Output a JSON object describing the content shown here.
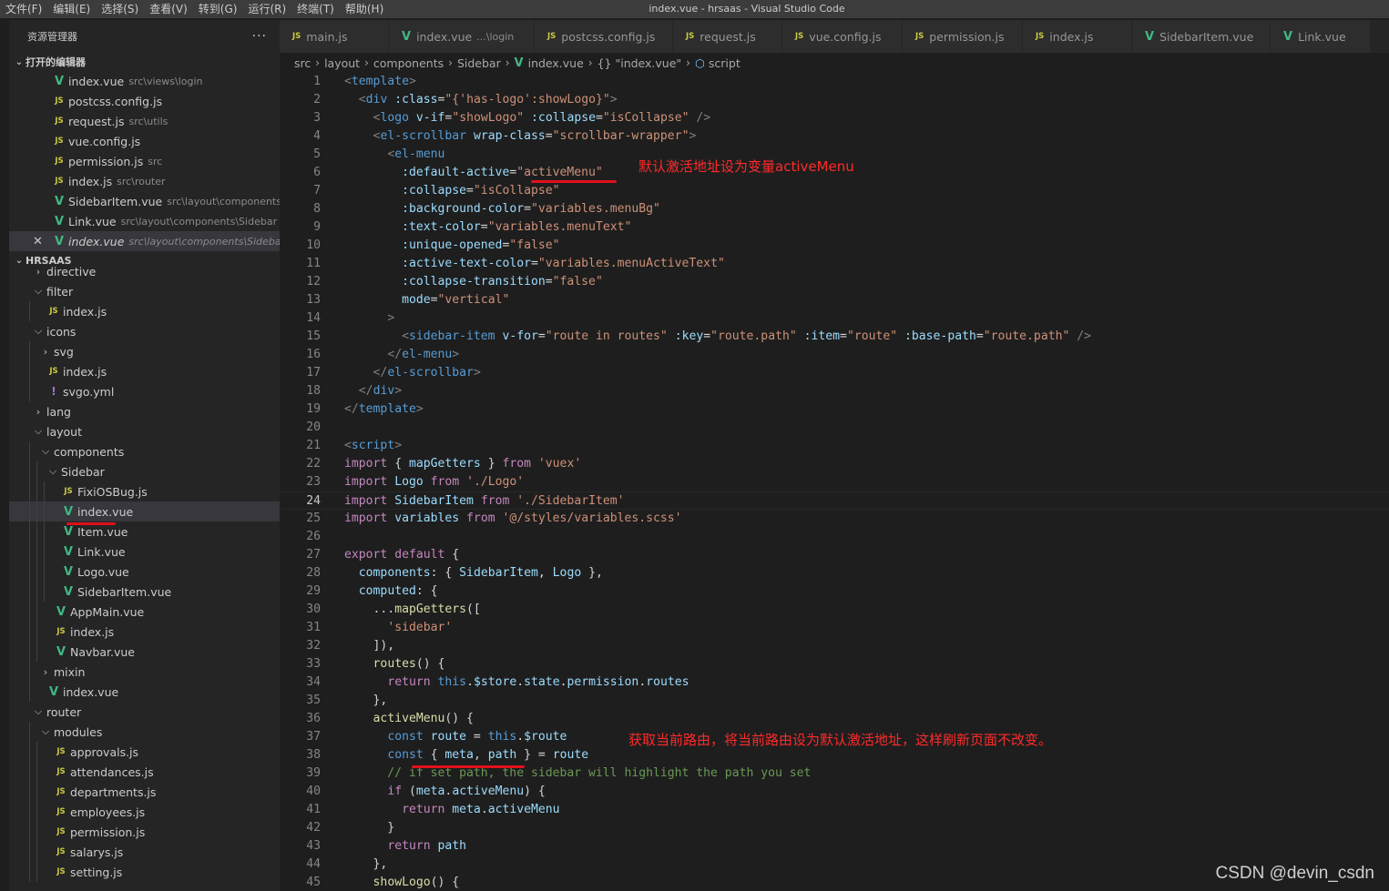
{
  "menu": [
    "文件(F)",
    "编辑(E)",
    "选择(S)",
    "查看(V)",
    "转到(G)",
    "运行(R)",
    "终端(T)",
    "帮助(H)"
  ],
  "window_title": "index.vue - hrsaas - Visual Studio Code",
  "explorer": {
    "title": "资源管理器",
    "more": "···",
    "open_editors_label": "打开的编辑器",
    "open_editors": [
      {
        "icon": "vue",
        "name": "index.vue",
        "path": "src\\views\\login"
      },
      {
        "icon": "js",
        "name": "postcss.config.js",
        "path": ""
      },
      {
        "icon": "js",
        "name": "request.js",
        "path": "src\\utils"
      },
      {
        "icon": "js",
        "name": "vue.config.js",
        "path": ""
      },
      {
        "icon": "js",
        "name": "permission.js",
        "path": "src"
      },
      {
        "icon": "js",
        "name": "index.js",
        "path": "src\\router"
      },
      {
        "icon": "vue",
        "name": "SidebarItem.vue",
        "path": "src\\layout\\components\\..."
      },
      {
        "icon": "vue",
        "name": "Link.vue",
        "path": "src\\layout\\components\\Sidebar"
      },
      {
        "icon": "vue",
        "name": "index.vue",
        "path": "src\\layout\\components\\Sidebar"
      }
    ],
    "project_label": "HRSAAS",
    "tree": [
      {
        "d": 1,
        "t": "dir",
        "o": false,
        "name": "directive"
      },
      {
        "d": 1,
        "t": "dir",
        "o": true,
        "name": "filter"
      },
      {
        "d": 2,
        "t": "js",
        "name": "index.js"
      },
      {
        "d": 1,
        "t": "dir",
        "o": true,
        "name": "icons"
      },
      {
        "d": 2,
        "t": "dir",
        "o": false,
        "name": "svg"
      },
      {
        "d": 2,
        "t": "js",
        "name": "index.js"
      },
      {
        "d": 2,
        "t": "yml",
        "name": "svgo.yml"
      },
      {
        "d": 1,
        "t": "dir",
        "o": false,
        "name": "lang"
      },
      {
        "d": 1,
        "t": "dir",
        "o": true,
        "name": "layout"
      },
      {
        "d": 2,
        "t": "dir",
        "o": true,
        "name": "components"
      },
      {
        "d": 3,
        "t": "dir",
        "o": true,
        "name": "Sidebar"
      },
      {
        "d": 4,
        "t": "js",
        "name": "FixiOSBug.js"
      },
      {
        "d": 4,
        "t": "vue",
        "name": "index.vue"
      },
      {
        "d": 4,
        "t": "vue",
        "name": "Item.vue"
      },
      {
        "d": 4,
        "t": "vue",
        "name": "Link.vue"
      },
      {
        "d": 4,
        "t": "vue",
        "name": "Logo.vue"
      },
      {
        "d": 4,
        "t": "vue",
        "name": "SidebarItem.vue"
      },
      {
        "d": 3,
        "t": "vue",
        "name": "AppMain.vue"
      },
      {
        "d": 3,
        "t": "js",
        "name": "index.js"
      },
      {
        "d": 3,
        "t": "vue",
        "name": "Navbar.vue"
      },
      {
        "d": 2,
        "t": "dir",
        "o": false,
        "name": "mixin"
      },
      {
        "d": 2,
        "t": "vue",
        "name": "index.vue"
      },
      {
        "d": 1,
        "t": "dir",
        "o": true,
        "name": "router"
      },
      {
        "d": 2,
        "t": "dir",
        "o": true,
        "name": "modules"
      },
      {
        "d": 3,
        "t": "js",
        "name": "approvals.js"
      },
      {
        "d": 3,
        "t": "js",
        "name": "attendances.js"
      },
      {
        "d": 3,
        "t": "js",
        "name": "departments.js"
      },
      {
        "d": 3,
        "t": "js",
        "name": "employees.js"
      },
      {
        "d": 3,
        "t": "js",
        "name": "permission.js"
      },
      {
        "d": 3,
        "t": "js",
        "name": "salarys.js"
      },
      {
        "d": 3,
        "t": "js",
        "name": "setting.js"
      }
    ]
  },
  "tabs": [
    {
      "icon": "js",
      "label": "main.js",
      "sub": ""
    },
    {
      "icon": "vue",
      "label": "index.vue",
      "sub": "...\\login"
    },
    {
      "icon": "js",
      "label": "postcss.config.js",
      "sub": ""
    },
    {
      "icon": "js",
      "label": "request.js",
      "sub": ""
    },
    {
      "icon": "js",
      "label": "vue.config.js",
      "sub": ""
    },
    {
      "icon": "js",
      "label": "permission.js",
      "sub": ""
    },
    {
      "icon": "js",
      "label": "index.js",
      "sub": ""
    },
    {
      "icon": "vue",
      "label": "SidebarItem.vue",
      "sub": ""
    },
    {
      "icon": "vue",
      "label": "Link.vue",
      "sub": ""
    }
  ],
  "breadcrumb": {
    "src": "src",
    "layout": "layout",
    "components": "components",
    "sidebar": "Sidebar",
    "file": "index.vue",
    "obj": "{} \"index.vue\"",
    "section": "script"
  },
  "code_lines": [
    "<template>",
    "  <div :class=\"{'has-logo':showLogo}\">",
    "    <logo v-if=\"showLogo\" :collapse=\"isCollapse\" />",
    "    <el-scrollbar wrap-class=\"scrollbar-wrapper\">",
    "      <el-menu",
    "        :default-active=\"activeMenu\"",
    "        :collapse=\"isCollapse\"",
    "        :background-color=\"variables.menuBg\"",
    "        :text-color=\"variables.menuText\"",
    "        :unique-opened=\"false\"",
    "        :active-text-color=\"variables.menuActiveText\"",
    "        :collapse-transition=\"false\"",
    "        mode=\"vertical\"",
    "      >",
    "        <sidebar-item v-for=\"route in routes\" :key=\"route.path\" :item=\"route\" :base-path=\"route.path\" />",
    "      </el-menu>",
    "    </el-scrollbar>",
    "  </div>",
    "</template>",
    "",
    "<script>",
    "import { mapGetters } from 'vuex'",
    "import Logo from './Logo'",
    "import SidebarItem from './SidebarItem'",
    "import variables from '@/styles/variables.scss'",
    "",
    "export default {",
    "  components: { SidebarItem, Logo },",
    "  computed: {",
    "    ...mapGetters([",
    "      'sidebar'",
    "    ]),",
    "    routes() {",
    "      return this.$store.state.permission.routes",
    "    },",
    "    activeMenu() {",
    "      const route = this.$route",
    "      const { meta, path } = route",
    "      // if set path, the sidebar will highlight the path you set",
    "      if (meta.activeMenu) {",
    "        return meta.activeMenu",
    "      }",
    "      return path",
    "    },",
    "    showLogo() {"
  ],
  "current_line": 24,
  "annotations": {
    "default_active_note": "默认激活地址设为变量activeMenu",
    "route_note": "获取当前路由，将当前路由设为默认激活地址，这样刷新页面不改变。"
  },
  "watermark": "CSDN @devin_csdn"
}
